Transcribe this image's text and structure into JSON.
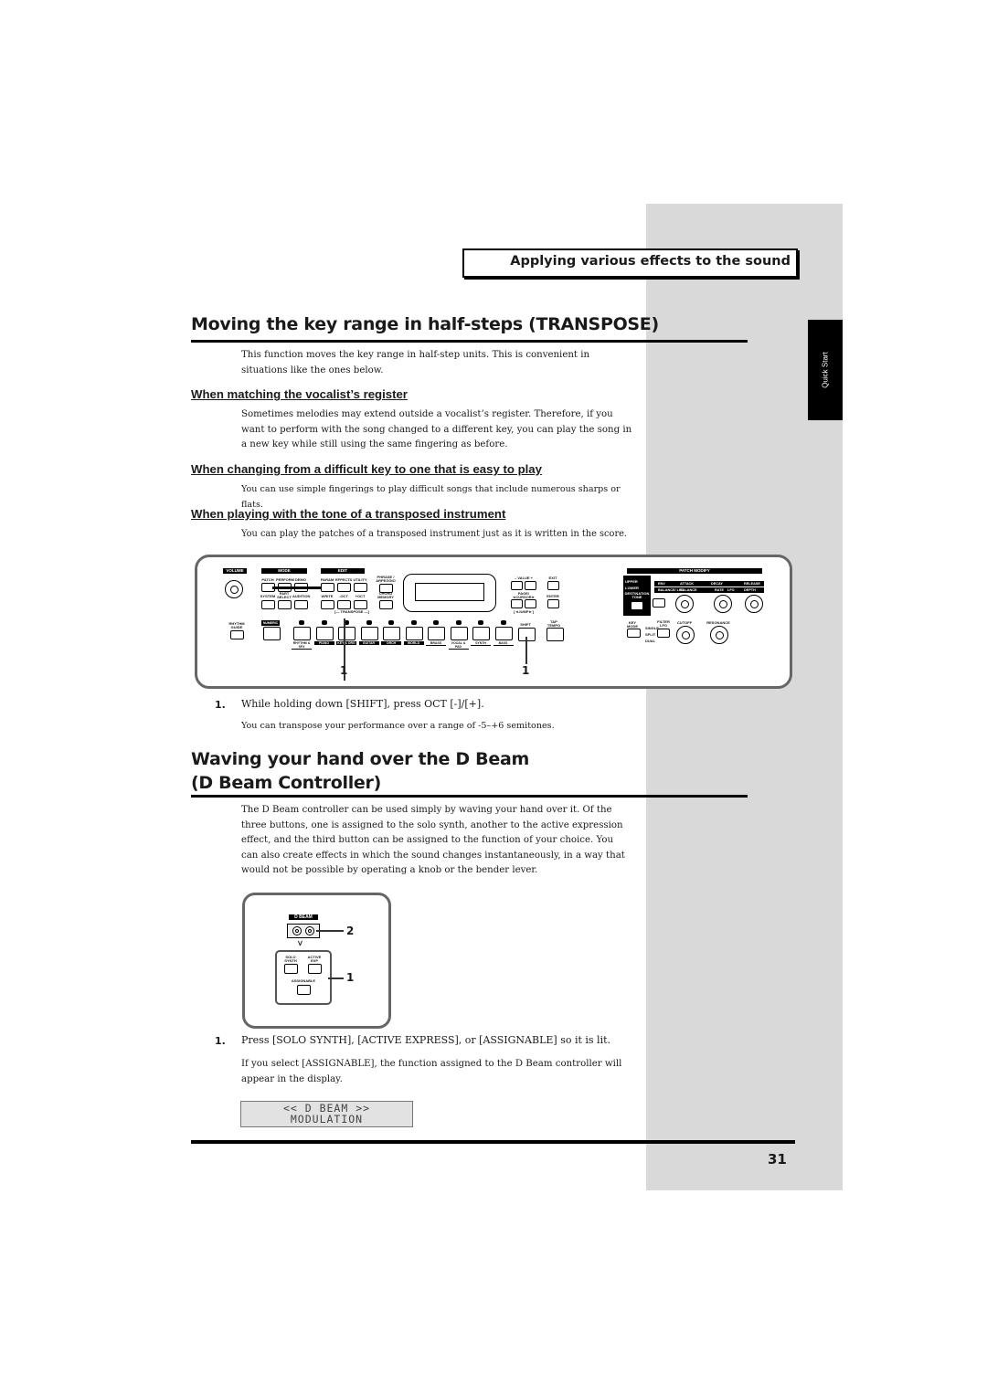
{
  "header": {
    "section_title": "Applying various effects to the sound",
    "side_tab": "Quick Start"
  },
  "transpose": {
    "title": "Moving the key range in half-steps (TRANSPOSE)",
    "intro": "This function moves the key range in half-step units. This is convenient in situations like the ones below.",
    "cases": [
      {
        "heading": "When matching the vocalist’s register",
        "text": "Sometimes melodies may extend outside a vocalist’s register. Therefore, if you want to perform with the song changed to a different key, you can play the song in a new key while still using the same fingering as before."
      },
      {
        "heading": "When changing from a difficult key to one that is easy to play",
        "text": "You can use simple fingerings to play difficult songs that include numerous sharps or flats."
      },
      {
        "heading": "When playing with the tone of a transposed instrument",
        "text": "You can play the patches of a transposed instrument just as it is written in the score."
      }
    ],
    "step_number": "1.",
    "step_text": "While holding down [SHIFT], press OCT [-]/[+].",
    "step_note": "You can transpose your performance over a range of -5–+6 semitones."
  },
  "panel": {
    "volume": "VOLUME",
    "mode": "MODE",
    "edit": "EDIT",
    "mode_buttons_top": [
      "PATCH",
      "PERFORM",
      "DEMO"
    ],
    "mode_buttons_bottom": [
      "SYSTEM",
      "PART SELECT",
      "AUDITION"
    ],
    "edit_buttons_top": [
      "PARAM",
      "EFFECTS",
      "UTILITY"
    ],
    "edit_buttons_bottom": [
      "WRITE",
      "-OCT",
      "+OCT"
    ],
    "transpose_label": "[— TRANSPOSE —]",
    "phrase": "PHRASE / ARPEGGIO",
    "chord": "CHORD MEMORY",
    "value": "– VALUE +",
    "exit": "EXIT",
    "page_cursor": "PAGE/ ◄CURSOR►",
    "enter": "ENTER",
    "jump": "[◄JUMP►]",
    "rhythm_guide": "RHYTHM GUIDE",
    "numeric": "NUMERIC",
    "shift": "SHIFT",
    "tap_tempo": "TAP TEMPO",
    "categories": [
      "RHYTHM & SFX",
      "PIANO",
      "KEY & ORG",
      "GUITAR",
      "ORCH",
      "WORLD",
      "BRASS",
      "VOCAL & PAD",
      "SYNTH",
      "BASS"
    ],
    "patch_modify": "PATCH MODIFY",
    "upper": "UPPER",
    "lower": "LOWER",
    "destination_tone": "DESTINATION TONE",
    "env": "ENV",
    "attack": "ATTACK",
    "decay": "DECAY",
    "release": "RELEASE",
    "balance_lfo": "BALANCE/ LFO",
    "balance": "BALANCE",
    "rate": "RATE",
    "lfo": "LFO",
    "depth": "DEPTH",
    "key_mode": "KEY MODE",
    "single": "SINGLE",
    "split": "SPLIT",
    "dual": "DUAL",
    "filter_lfo": "FILTER LFO",
    "cutoff": "CUTOFF",
    "resonance": "RESONANCE",
    "callout_left": "1",
    "callout_right": "1"
  },
  "dbeam": {
    "title_line1": "Waving your hand over the D Beam",
    "title_line2": "(D Beam Controller)",
    "intro": "The D Beam controller can be used simply by waving your hand over it. Of the three buttons, one is assigned to the solo synth, another to the active expression effect, and the third button can be assigned to the function of your choice. You can also create effects in which the sound changes instantaneously, in a way that would not be possible by operating a knob or the bender lever.",
    "panel_label": "D BEAM",
    "solo_synth": "SOLO SYNTH",
    "active_exp": "ACTIVE EXP",
    "assignable": "ASSIGNABLE",
    "callout_2": "2",
    "callout_1": "1",
    "step_number": "1.",
    "step_text": "Press [SOLO SYNTH], [ACTIVE EXPRESS], or [ASSIGNABLE] so it is lit.",
    "step_note": "If you select [ASSIGNABLE], the function assigned to the D Beam controller will appear in the display.",
    "lcd_line1": "<< D BEAM >>",
    "lcd_line2": "MODULATION"
  },
  "footer": {
    "page_number": "31"
  }
}
